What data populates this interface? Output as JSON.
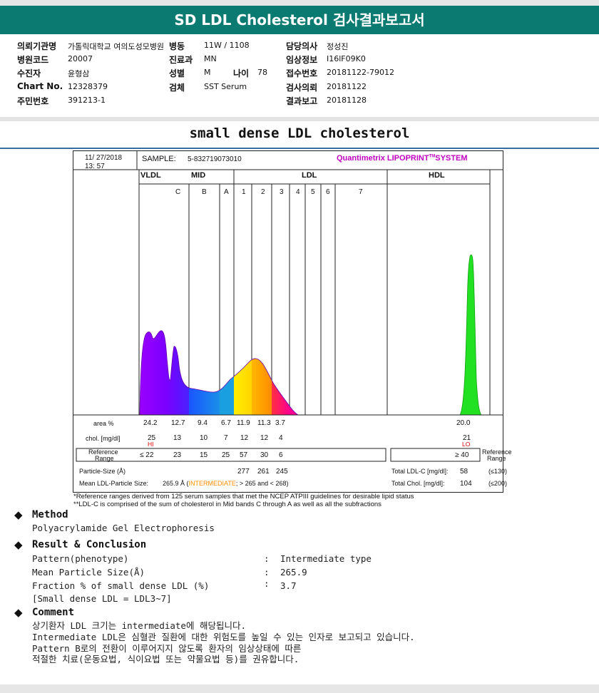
{
  "header": {
    "title": "SD LDL Cholesterol 검사결과보고서"
  },
  "info": {
    "r1": [
      {
        "label": "의뢰기관명",
        "value": "가톨릭대학교 여의도성모병원"
      },
      {
        "label": "병동",
        "value": "11W / 1108"
      },
      {
        "label": "담당의사",
        "value": "정성진"
      }
    ],
    "r2": [
      {
        "label": "병원코드",
        "value": "20007"
      },
      {
        "label": "진료과",
        "value": "MN"
      },
      {
        "label": "임상정보",
        "value": "I16lF09K0"
      }
    ],
    "r3": [
      {
        "label": "수진자",
        "value": "윤형삼"
      },
      {
        "label": "성별",
        "value": "M"
      },
      {
        "label": "나이",
        "value": "78"
      },
      {
        "label": "접수번호",
        "value": "20181122-79012"
      }
    ],
    "r4": [
      {
        "label": "Chart No.",
        "value": "12328379"
      },
      {
        "label": "검체",
        "value": "SST Serum"
      },
      {
        "label": "검사의뢰",
        "value": "20181122"
      }
    ],
    "r5": [
      {
        "label": "주민번호",
        "value": "391213-1"
      },
      {
        "label": "결과보고",
        "value": "20181128"
      }
    ]
  },
  "section_title": "small dense LDL cholesterol",
  "report": {
    "date": "11/ 27/2018",
    "time": "13: 57",
    "sample_label": "SAMPLE:",
    "sample_id": "5-832719073010",
    "brand": "Quantimetrix LIPOPRINT",
    "brand_tm": "TM",
    "brand_system": "SYSTEM",
    "groups": [
      "VLDL",
      "MID",
      "LDL",
      "HDL"
    ],
    "bands": [
      "C",
      "B",
      "A",
      "1",
      "2",
      "3",
      "4",
      "5",
      "6",
      "7"
    ],
    "area_label": "area %",
    "area_values": [
      "24.2",
      "12.7",
      "9.4",
      "6.7",
      "11.9",
      "11.3",
      "3.7"
    ],
    "hdl_area": "20.0",
    "chol_label": "chol. [mg/dl]",
    "chol_values": [
      "25",
      "13",
      "10",
      "7",
      "12",
      "12",
      "4"
    ],
    "hdl_chol": "21",
    "hi_flag": "HI",
    "lo_flag": "LO",
    "ref_label_1": "Reference",
    "ref_label_2": "Range",
    "ref_values": [
      "≤ 22",
      "23",
      "15",
      "25",
      "57",
      "30",
      "6"
    ],
    "hdl_ref": "≥ 40",
    "ref_right_1": "Reference",
    "ref_right_2": "Range",
    "psize_label": "Particle-Size (Å)",
    "psize_values": [
      "277",
      "261",
      "245"
    ],
    "total_ldl_label": "Total LDL-C [mg/dl]:",
    "total_ldl_value": "58",
    "total_ldl_ref": "(≤130)",
    "mean_label": "Mean LDL-Particle Size:",
    "mean_value": "265.9 Å",
    "mean_open": "(",
    "mean_type": "INTERMEDIATE",
    "mean_range": "; > 265 and < 268)",
    "total_chol_label": "Total Chol. [mg/dl]:",
    "total_chol_value": "104",
    "total_chol_ref": "(≤200)"
  },
  "footnotes": [
    "*Reference ranges derived from 125 serum samples that met the NCEP ATPIII guidelines for desirable lipid status",
    "**LDL-C is comprised of the sum of cholesterol in Mid bands C through A as well as all the subfractions"
  ],
  "method": {
    "bullet": "◆",
    "heading": "Method",
    "text": "Polyacrylamide Gel Electrophoresis"
  },
  "result": {
    "bullet": "◆",
    "heading": "Result & Conclusion",
    "rows": [
      {
        "label": "Pattern(phenotype)",
        "colon": ":",
        "value": "Intermediate type"
      },
      {
        "label": "Mean Particle Size(Å)",
        "colon": ":",
        "value": "265.9"
      },
      {
        "label": "Fraction % of small dense LDL (%)",
        "colon": ":",
        "value": "3.7"
      }
    ],
    "note": "[Small dense LDL = LDL3~7]"
  },
  "comment": {
    "bullet": "◆",
    "heading": "Comment",
    "lines": [
      "상기환자 LDL 크기는 intermediate에 해당됩니다.",
      "Intermediate LDL은 심혈관 질환에 대한 위험도를 높일 수 있는 인자로 보고되고 있습니다.",
      "Pattern B로의 전환이 이루어지지 않도록 환자의 임상상태에 따른",
      "적절한 치료(운동요법, 식이요법 또는 약물요법 등)를 권유합니다."
    ]
  },
  "colors": {
    "title_bar": "#0b7a70",
    "brand": "#c000c0",
    "hi_lo": "#e00000",
    "intermediate": "#ff8c00"
  }
}
